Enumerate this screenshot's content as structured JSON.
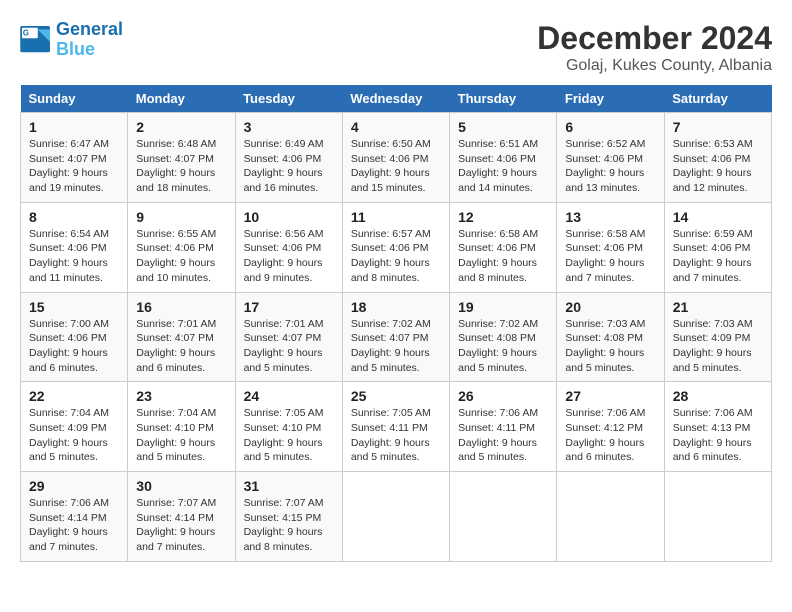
{
  "logo": {
    "line1": "General",
    "line2": "Blue"
  },
  "title": "December 2024",
  "subtitle": "Golaj, Kukes County, Albania",
  "days_header": [
    "Sunday",
    "Monday",
    "Tuesday",
    "Wednesday",
    "Thursday",
    "Friday",
    "Saturday"
  ],
  "weeks": [
    [
      {
        "day": "1",
        "sunrise": "6:47 AM",
        "sunset": "4:07 PM",
        "daylight": "9 hours and 19 minutes."
      },
      {
        "day": "2",
        "sunrise": "6:48 AM",
        "sunset": "4:07 PM",
        "daylight": "9 hours and 18 minutes."
      },
      {
        "day": "3",
        "sunrise": "6:49 AM",
        "sunset": "4:06 PM",
        "daylight": "9 hours and 16 minutes."
      },
      {
        "day": "4",
        "sunrise": "6:50 AM",
        "sunset": "4:06 PM",
        "daylight": "9 hours and 15 minutes."
      },
      {
        "day": "5",
        "sunrise": "6:51 AM",
        "sunset": "4:06 PM",
        "daylight": "9 hours and 14 minutes."
      },
      {
        "day": "6",
        "sunrise": "6:52 AM",
        "sunset": "4:06 PM",
        "daylight": "9 hours and 13 minutes."
      },
      {
        "day": "7",
        "sunrise": "6:53 AM",
        "sunset": "4:06 PM",
        "daylight": "9 hours and 12 minutes."
      }
    ],
    [
      {
        "day": "8",
        "sunrise": "6:54 AM",
        "sunset": "4:06 PM",
        "daylight": "9 hours and 11 minutes."
      },
      {
        "day": "9",
        "sunrise": "6:55 AM",
        "sunset": "4:06 PM",
        "daylight": "9 hours and 10 minutes."
      },
      {
        "day": "10",
        "sunrise": "6:56 AM",
        "sunset": "4:06 PM",
        "daylight": "9 hours and 9 minutes."
      },
      {
        "day": "11",
        "sunrise": "6:57 AM",
        "sunset": "4:06 PM",
        "daylight": "9 hours and 8 minutes."
      },
      {
        "day": "12",
        "sunrise": "6:58 AM",
        "sunset": "4:06 PM",
        "daylight": "9 hours and 8 minutes."
      },
      {
        "day": "13",
        "sunrise": "6:58 AM",
        "sunset": "4:06 PM",
        "daylight": "9 hours and 7 minutes."
      },
      {
        "day": "14",
        "sunrise": "6:59 AM",
        "sunset": "4:06 PM",
        "daylight": "9 hours and 7 minutes."
      }
    ],
    [
      {
        "day": "15",
        "sunrise": "7:00 AM",
        "sunset": "4:06 PM",
        "daylight": "9 hours and 6 minutes."
      },
      {
        "day": "16",
        "sunrise": "7:01 AM",
        "sunset": "4:07 PM",
        "daylight": "9 hours and 6 minutes."
      },
      {
        "day": "17",
        "sunrise": "7:01 AM",
        "sunset": "4:07 PM",
        "daylight": "9 hours and 5 minutes."
      },
      {
        "day": "18",
        "sunrise": "7:02 AM",
        "sunset": "4:07 PM",
        "daylight": "9 hours and 5 minutes."
      },
      {
        "day": "19",
        "sunrise": "7:02 AM",
        "sunset": "4:08 PM",
        "daylight": "9 hours and 5 minutes."
      },
      {
        "day": "20",
        "sunrise": "7:03 AM",
        "sunset": "4:08 PM",
        "daylight": "9 hours and 5 minutes."
      },
      {
        "day": "21",
        "sunrise": "7:03 AM",
        "sunset": "4:09 PM",
        "daylight": "9 hours and 5 minutes."
      }
    ],
    [
      {
        "day": "22",
        "sunrise": "7:04 AM",
        "sunset": "4:09 PM",
        "daylight": "9 hours and 5 minutes."
      },
      {
        "day": "23",
        "sunrise": "7:04 AM",
        "sunset": "4:10 PM",
        "daylight": "9 hours and 5 minutes."
      },
      {
        "day": "24",
        "sunrise": "7:05 AM",
        "sunset": "4:10 PM",
        "daylight": "9 hours and 5 minutes."
      },
      {
        "day": "25",
        "sunrise": "7:05 AM",
        "sunset": "4:11 PM",
        "daylight": "9 hours and 5 minutes."
      },
      {
        "day": "26",
        "sunrise": "7:06 AM",
        "sunset": "4:11 PM",
        "daylight": "9 hours and 5 minutes."
      },
      {
        "day": "27",
        "sunrise": "7:06 AM",
        "sunset": "4:12 PM",
        "daylight": "9 hours and 6 minutes."
      },
      {
        "day": "28",
        "sunrise": "7:06 AM",
        "sunset": "4:13 PM",
        "daylight": "9 hours and 6 minutes."
      }
    ],
    [
      {
        "day": "29",
        "sunrise": "7:06 AM",
        "sunset": "4:14 PM",
        "daylight": "9 hours and 7 minutes."
      },
      {
        "day": "30",
        "sunrise": "7:07 AM",
        "sunset": "4:14 PM",
        "daylight": "9 hours and 7 minutes."
      },
      {
        "day": "31",
        "sunrise": "7:07 AM",
        "sunset": "4:15 PM",
        "daylight": "9 hours and 8 minutes."
      },
      null,
      null,
      null,
      null
    ]
  ],
  "labels": {
    "sunrise": "Sunrise:",
    "sunset": "Sunset:",
    "daylight": "Daylight:"
  }
}
